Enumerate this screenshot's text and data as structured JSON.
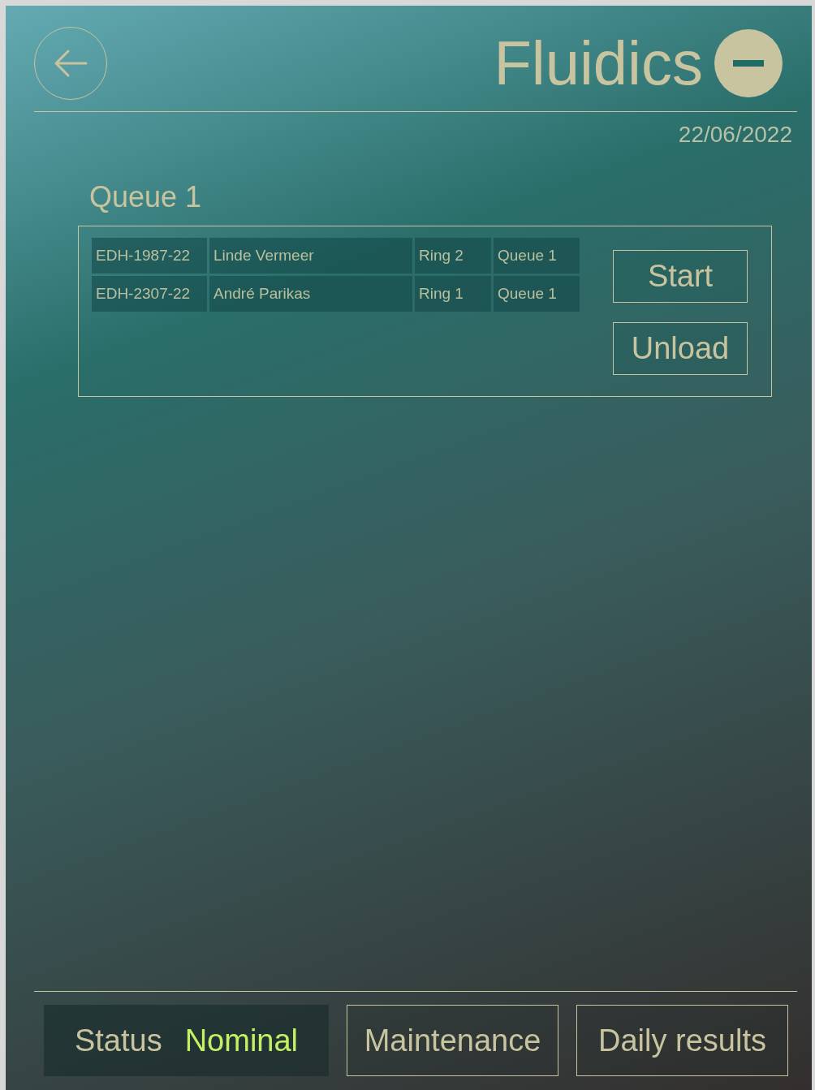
{
  "header": {
    "title": "Fluidics",
    "date": "22/06/2022"
  },
  "queue": {
    "title": "Queue 1",
    "rows": [
      [
        "EDH-1987-22",
        "Linde Vermeer",
        "Ring 2",
        "Queue 1"
      ],
      [
        "EDH-2307-22",
        "André Parikas",
        "Ring 1",
        "Queue 1"
      ]
    ],
    "buttons": [
      "Start",
      "Unload"
    ]
  },
  "footer": {
    "status": {
      "label": "Status",
      "value": "Nominal",
      "ok": true
    },
    "buttons": [
      "Maintenance",
      "Daily results"
    ]
  }
}
